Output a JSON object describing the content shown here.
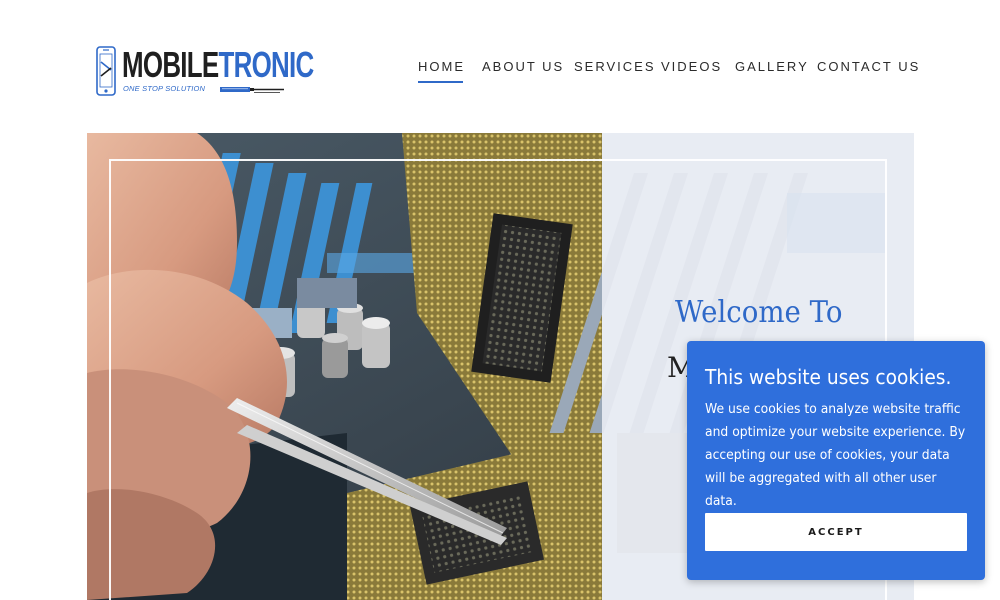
{
  "logo": {
    "word_part1": "MOBILE",
    "word_part2": "TRONIC",
    "tagline": "ONE STOP SOLUTION",
    "icon": "phone-tools-icon",
    "tool_icon": "screwdriver-icon"
  },
  "nav": {
    "items": [
      {
        "label": "HOME",
        "active": true
      },
      {
        "label": "ABOUT US",
        "active": false
      },
      {
        "label": "SERVICES",
        "active": false
      },
      {
        "label": "VIDEOS",
        "active": false
      },
      {
        "label": "GALLERY",
        "active": false
      },
      {
        "label": "CONTACT US",
        "active": false
      }
    ]
  },
  "hero": {
    "welcome": "Welcome To",
    "subtitle_visible": "M"
  },
  "cookie": {
    "title": "This website uses cookies.",
    "text": "We use cookies to analyze website traffic and optimize your website experience. By accepting our use of cookies, your data will be aggregated with all other user data.",
    "accept_label": "ACCEPT"
  },
  "colors": {
    "accent": "#2f69c8",
    "cookie_bg": "#2f6fdc",
    "nav_text": "#2b2b2b"
  }
}
